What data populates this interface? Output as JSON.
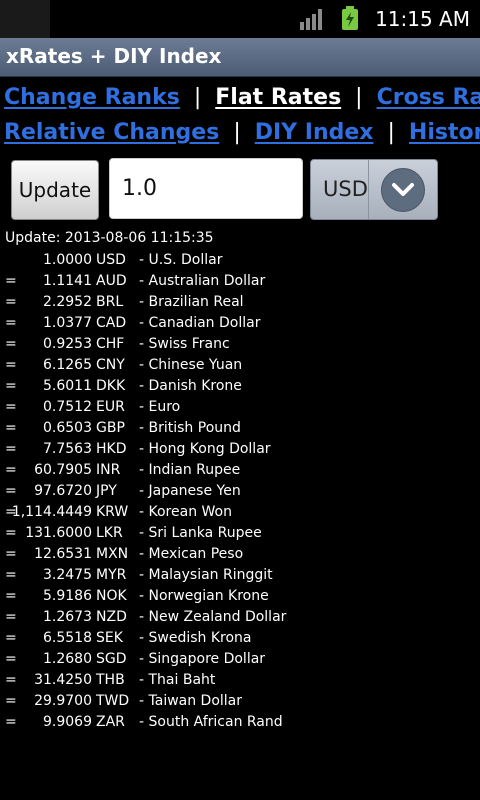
{
  "status_bar": {
    "time": "11:15 AM",
    "icons": [
      "notification-icon",
      "signal-icon",
      "battery-charging-icon"
    ]
  },
  "app": {
    "title": "xRates + DIY Index"
  },
  "nav": {
    "separator": "|",
    "items": [
      {
        "label": "Change Ranks",
        "active": false
      },
      {
        "label": "Flat Rates",
        "active": true
      },
      {
        "label": "Cross Rates",
        "active": false
      },
      {
        "label": "Relative Changes",
        "active": false
      },
      {
        "label": "DIY Index",
        "active": false
      },
      {
        "label": "Historical",
        "active": false
      }
    ]
  },
  "controls": {
    "update_label": "Update",
    "amount_value": "1.0",
    "currency": "USD",
    "dropdown_icon": "chevron-down-icon"
  },
  "rates": {
    "update_text": "Update: 2013-08-06 11:15:35",
    "rows": [
      {
        "eq": "",
        "value": "1.0000",
        "code": "USD",
        "name": "- U.S. Dollar"
      },
      {
        "eq": "=",
        "value": "1.1141",
        "code": "AUD",
        "name": "- Australian Dollar"
      },
      {
        "eq": "=",
        "value": "2.2952",
        "code": "BRL",
        "name": "- Brazilian Real"
      },
      {
        "eq": "=",
        "value": "1.0377",
        "code": "CAD",
        "name": "- Canadian Dollar"
      },
      {
        "eq": "=",
        "value": "0.9253",
        "code": "CHF",
        "name": "- Swiss Franc"
      },
      {
        "eq": "=",
        "value": "6.1265",
        "code": "CNY",
        "name": "- Chinese Yuan"
      },
      {
        "eq": "=",
        "value": "5.6011",
        "code": "DKK",
        "name": "- Danish Krone"
      },
      {
        "eq": "=",
        "value": "0.7512",
        "code": "EUR",
        "name": "- Euro"
      },
      {
        "eq": "=",
        "value": "0.6503",
        "code": "GBP",
        "name": "- British Pound"
      },
      {
        "eq": "=",
        "value": "7.7563",
        "code": "HKD",
        "name": "- Hong Kong Dollar"
      },
      {
        "eq": "=",
        "value": "60.7905",
        "code": "INR",
        "name": "- Indian Rupee"
      },
      {
        "eq": "=",
        "value": "97.6720",
        "code": "JPY",
        "name": "- Japanese Yen"
      },
      {
        "eq": "=",
        "value": "1,114.4449",
        "code": "KRW",
        "name": "- Korean Won"
      },
      {
        "eq": "=",
        "value": "131.6000",
        "code": "LKR",
        "name": "- Sri Lanka Rupee"
      },
      {
        "eq": "=",
        "value": "12.6531",
        "code": "MXN",
        "name": "- Mexican Peso"
      },
      {
        "eq": "=",
        "value": "3.2475",
        "code": "MYR",
        "name": "- Malaysian Ringgit"
      },
      {
        "eq": "=",
        "value": "5.9186",
        "code": "NOK",
        "name": "- Norwegian Krone"
      },
      {
        "eq": "=",
        "value": "1.2673",
        "code": "NZD",
        "name": "- New Zealand Dollar"
      },
      {
        "eq": "=",
        "value": "6.5518",
        "code": "SEK",
        "name": "- Swedish Krona"
      },
      {
        "eq": "=",
        "value": "1.2680",
        "code": "SGD",
        "name": "- Singapore Dollar"
      },
      {
        "eq": "=",
        "value": "31.4250",
        "code": "THB",
        "name": "- Thai Baht"
      },
      {
        "eq": "=",
        "value": "29.9700",
        "code": "TWD",
        "name": "- Taiwan Dollar"
      },
      {
        "eq": "=",
        "value": "9.9069",
        "code": "ZAR",
        "name": "- South African Rand"
      }
    ]
  }
}
